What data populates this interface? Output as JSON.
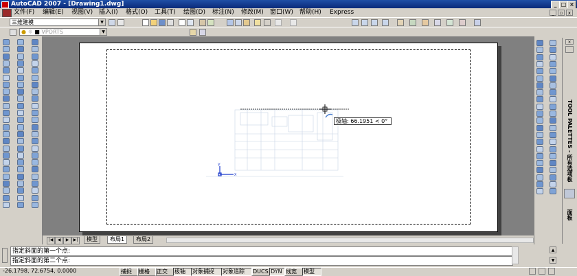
{
  "app": {
    "title": "AutoCAD 2007 - [Drawing1.dwg]",
    "window_buttons": [
      "_",
      "□",
      "×"
    ]
  },
  "menu": {
    "items": [
      "文件(F)",
      "编辑(E)",
      "视图(V)",
      "插入(I)",
      "格式(O)",
      "工具(T)",
      "绘图(D)",
      "标注(N)",
      "修改(M)",
      "窗口(W)",
      "帮助(H)",
      "Express"
    ]
  },
  "toolbar": {
    "workspace_value": "三维建模",
    "layer_value": "VPORTS"
  },
  "canvas": {
    "polar_tooltip": "极轴: 66.1951 < 0°",
    "ucs_x": "X",
    "ucs_y": "Y"
  },
  "tabs": {
    "items": [
      "模型",
      "布局1",
      "布局2"
    ],
    "active": "布局1"
  },
  "command": {
    "line1": "指定斜面的第一个点:",
    "line2": "指定斜面的第二个点:"
  },
  "status": {
    "coords": "-26.1798, 72.6754, 0.0000",
    "toggles": [
      "捕捉",
      "栅格",
      "正交",
      "极轴",
      "对象捕捉",
      "对象追踪",
      "DUCS",
      "DYN",
      "线宽",
      "模型"
    ],
    "on_toggles": [
      "极轴",
      "对象捕捉",
      "对象追踪",
      "DYN",
      "模型"
    ]
  },
  "palette": {
    "label1": "TOOL PALETTES - 所有选项板",
    "label2": "面板"
  },
  "colors": {
    "titlebar": "#0a2a7a",
    "ui_face": "#d4d0c8",
    "model_space": "#808080",
    "ucs_blue": "#1a3acc"
  }
}
